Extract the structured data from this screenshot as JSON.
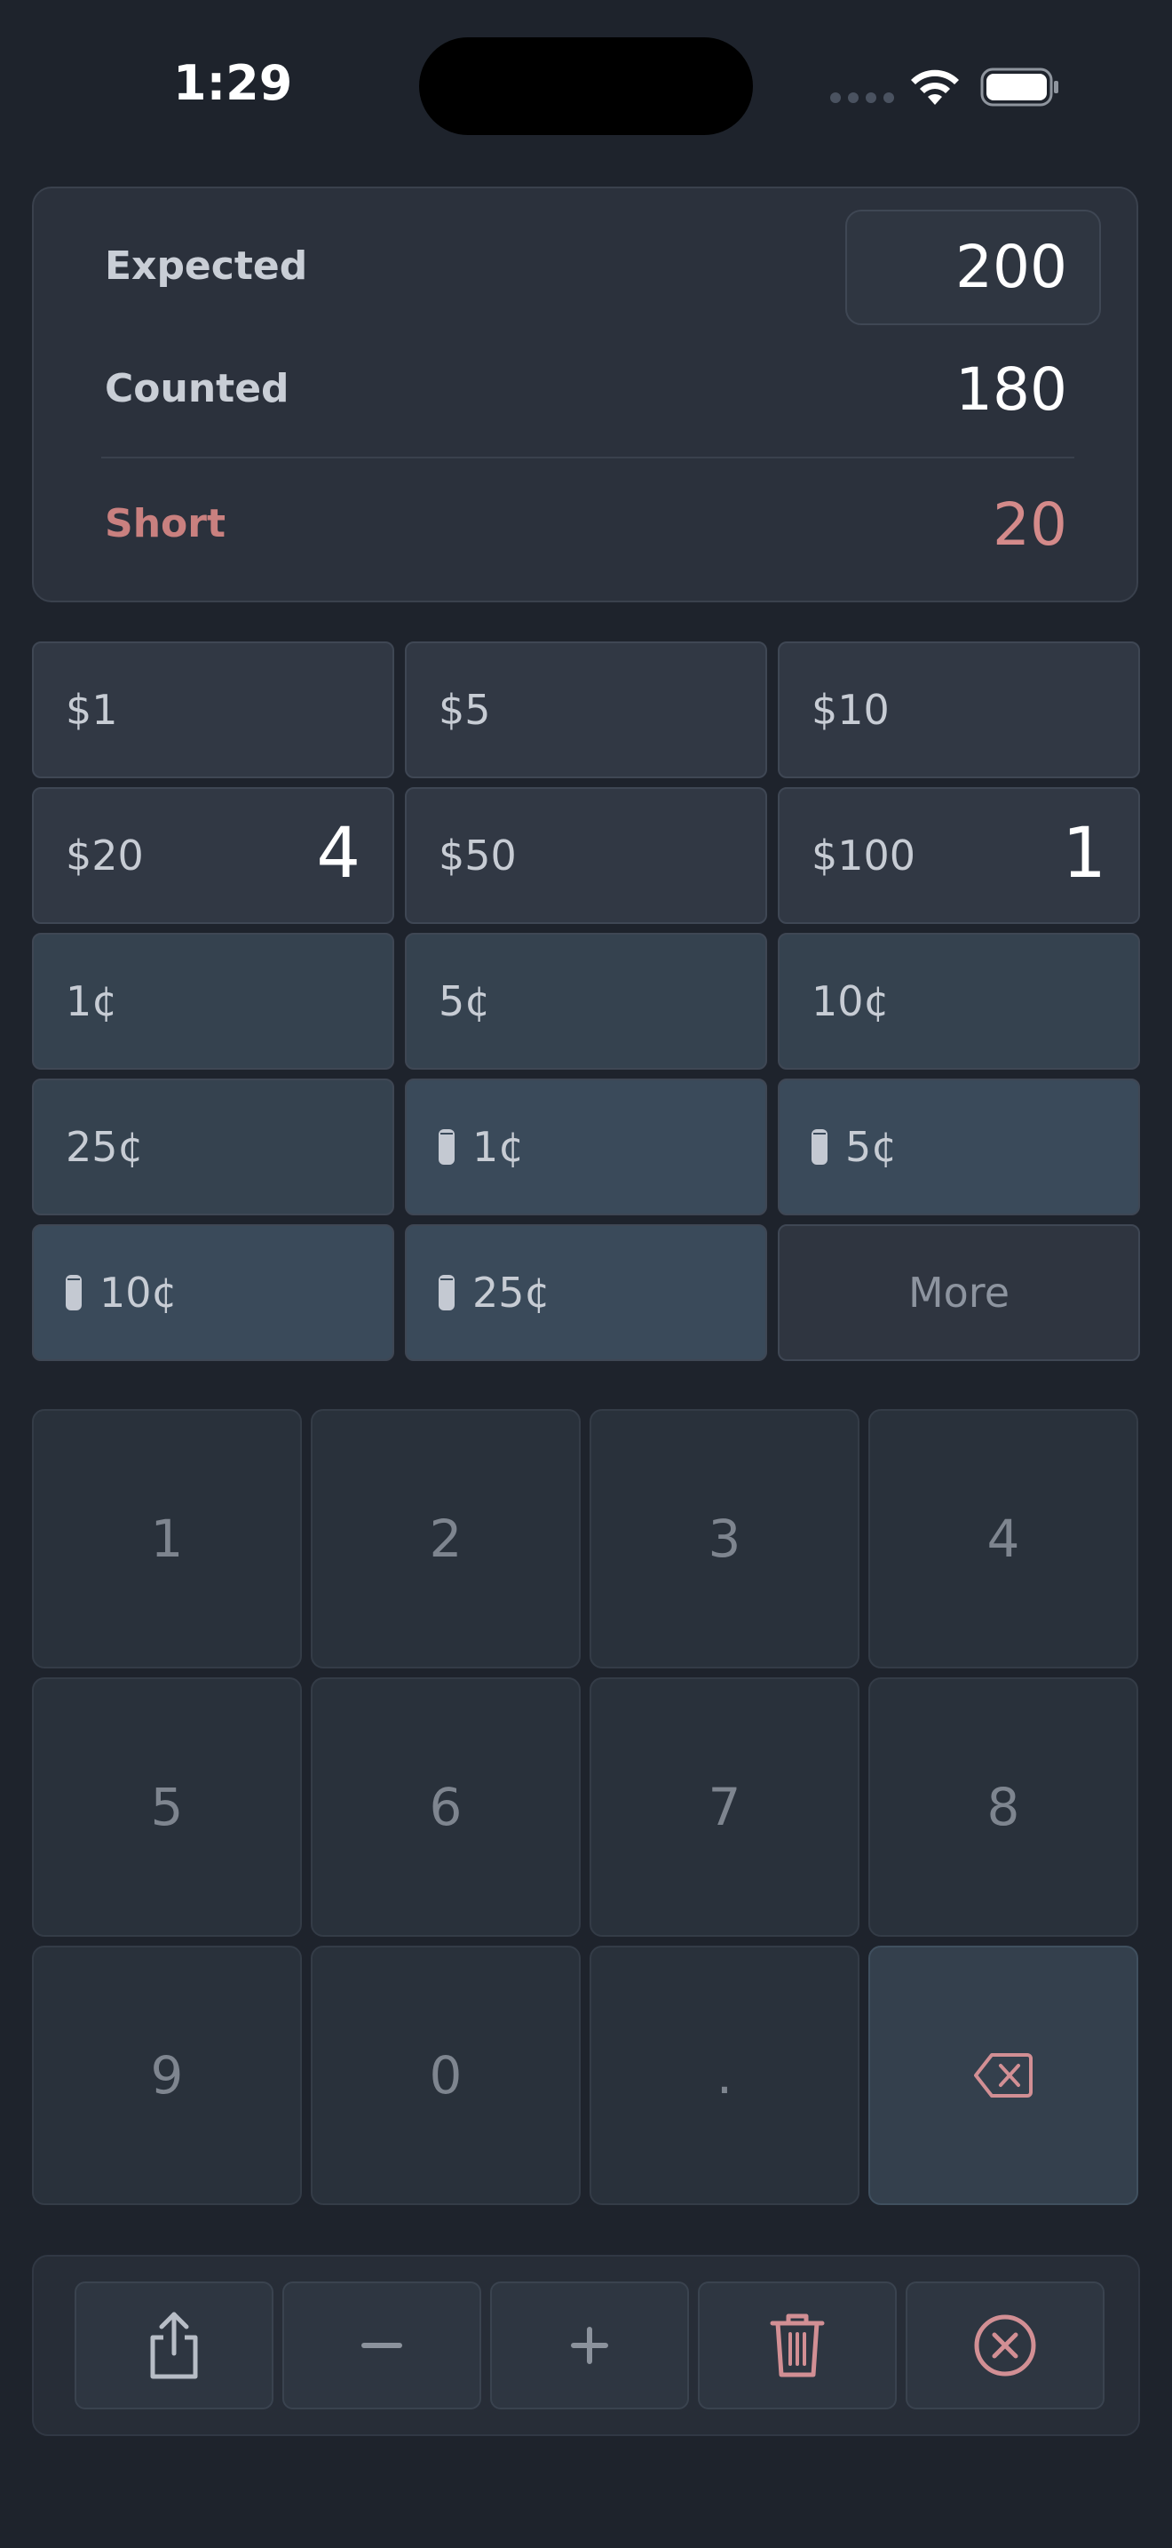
{
  "status_bar": {
    "time": "1:29"
  },
  "summary": {
    "expected_label": "Expected",
    "expected_value": "200",
    "counted_label": "Counted",
    "counted_value": "180",
    "short_label": "Short",
    "short_value": "20"
  },
  "denominations": [
    {
      "label": "$1",
      "count": "",
      "kind": "bill"
    },
    {
      "label": "$5",
      "count": "",
      "kind": "bill"
    },
    {
      "label": "$10",
      "count": "",
      "kind": "bill"
    },
    {
      "label": "$20",
      "count": "4",
      "kind": "bill"
    },
    {
      "label": "$50",
      "count": "",
      "kind": "bill"
    },
    {
      "label": "$100",
      "count": "1",
      "kind": "bill"
    },
    {
      "label": "1¢",
      "count": "",
      "kind": "coin"
    },
    {
      "label": "5¢",
      "count": "",
      "kind": "coin"
    },
    {
      "label": "10¢",
      "count": "",
      "kind": "coin"
    },
    {
      "label": "25¢",
      "count": "",
      "kind": "coin"
    },
    {
      "label": "1¢",
      "count": "",
      "kind": "roll"
    },
    {
      "label": "5¢",
      "count": "",
      "kind": "roll"
    },
    {
      "label": "10¢",
      "count": "",
      "kind": "roll"
    },
    {
      "label": "25¢",
      "count": "",
      "kind": "roll"
    }
  ],
  "more_label": "More",
  "keypad": {
    "keys": [
      "1",
      "2",
      "3",
      "4",
      "5",
      "6",
      "7",
      "8",
      "9",
      "0",
      "."
    ]
  },
  "icons": {
    "share": "share-icon",
    "minus": "minus-icon",
    "plus": "plus-icon",
    "trash": "trash-icon",
    "clear": "close-circle-icon",
    "backspace": "backspace-icon",
    "roll": "coin-roll-icon"
  },
  "colors": {
    "background": "#1e232c",
    "short": "#d48a8a",
    "destructive_icon": "#d28f94",
    "neutral_icon": "#8b929c"
  }
}
